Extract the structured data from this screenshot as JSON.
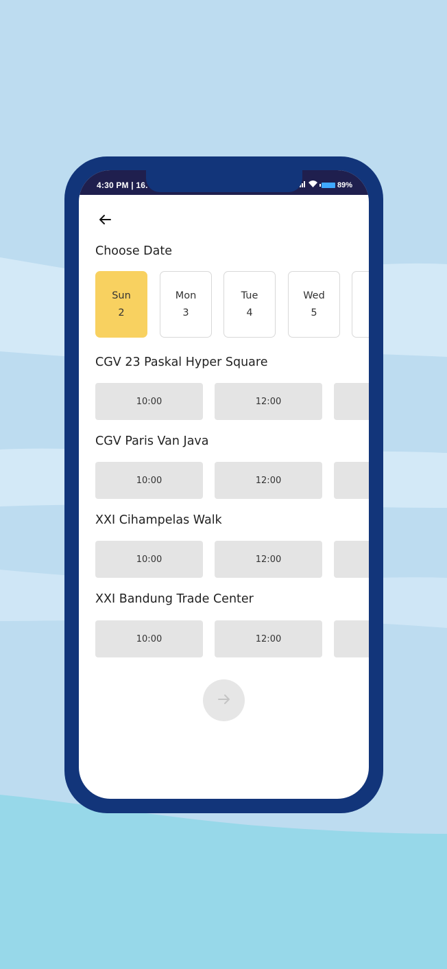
{
  "colors": {
    "background": "#bddcf0",
    "phone_frame": "#12357a",
    "selected_date": "#f8d160",
    "time_button": "#e4e4e4",
    "statusbar": "#1f1f4e"
  },
  "statusbar": {
    "time": "4:30 PM | 16.",
    "battery": "89%"
  },
  "header": {
    "back_icon": "arrow-left-icon"
  },
  "date_section": {
    "title": "Choose Date",
    "dates": [
      {
        "day": "Sun",
        "num": "2",
        "selected": true
      },
      {
        "day": "Mon",
        "num": "3",
        "selected": false
      },
      {
        "day": "Tue",
        "num": "4",
        "selected": false
      },
      {
        "day": "Wed",
        "num": "5",
        "selected": false
      },
      {
        "day": "",
        "num": "",
        "selected": false
      }
    ]
  },
  "cinemas": [
    {
      "name": "CGV 23 Paskal Hyper Square",
      "times": [
        "10:00",
        "12:00",
        ""
      ]
    },
    {
      "name": "CGV Paris Van Java",
      "times": [
        "10:00",
        "12:00",
        ""
      ]
    },
    {
      "name": "XXI Cihampelas Walk",
      "times": [
        "10:00",
        "12:00",
        ""
      ]
    },
    {
      "name": "XXI Bandung Trade Center",
      "times": [
        "10:00",
        "12:00",
        ""
      ]
    }
  ],
  "footer": {
    "next_icon": "arrow-right-icon"
  }
}
